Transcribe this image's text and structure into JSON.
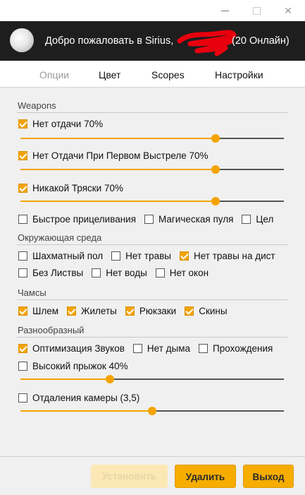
{
  "window": {
    "minimize_glyph": "",
    "maximize_glyph": "",
    "close_glyph": "✕"
  },
  "header": {
    "welcome": "Добро пожаловать в Sirius,",
    "online": "(20 Онлайн)",
    "redact_color": "#e8000e"
  },
  "tabs": [
    "Опции",
    "Цвет",
    "Scopes",
    "Настройки"
  ],
  "sections": {
    "weapons": "Weapons",
    "environment": "Окружающая среда",
    "chams": "Чамсы",
    "misc": "Разнообразный"
  },
  "weapons": {
    "no_recoil": {
      "label": "Нет отдачи 70%",
      "checked": true,
      "value": 0.74
    },
    "no_first_recoil": {
      "label": "Нет Отдачи При Первом Выстреле 70%",
      "checked": true,
      "value": 0.74
    },
    "no_shake": {
      "label": "Никакой Тряски 70%",
      "checked": true,
      "value": 0.74
    },
    "row": [
      {
        "label": "Быстрое прицеливания",
        "checked": false
      },
      {
        "label": "Магическая пуля",
        "checked": false
      },
      {
        "label": "Цел",
        "checked": false
      }
    ]
  },
  "environment": {
    "row1": [
      {
        "label": "Шахматный пол",
        "checked": false
      },
      {
        "label": "Нет травы",
        "checked": false
      },
      {
        "label": "Нет травы на дист",
        "checked": true
      }
    ],
    "row2": [
      {
        "label": "Без Листвы",
        "checked": false
      },
      {
        "label": "Нет воды",
        "checked": false
      },
      {
        "label": "Нет окон",
        "checked": false
      }
    ]
  },
  "chams": [
    {
      "label": "Шлем",
      "checked": true
    },
    {
      "label": "Жилеты",
      "checked": true
    },
    {
      "label": "Рюкзаки",
      "checked": true
    },
    {
      "label": "Скины",
      "checked": true
    }
  ],
  "misc": {
    "row": [
      {
        "label": "Оптимизация Звуков",
        "checked": true
      },
      {
        "label": "Нет дыма",
        "checked": false
      },
      {
        "label": "Прохождения",
        "checked": false
      }
    ],
    "high_jump": {
      "label": "Высокий прыжок 40%",
      "checked": false,
      "value": 0.34
    },
    "camera_distance": {
      "label": "Отдаления камеры (3,5)",
      "checked": false,
      "value": 0.5
    }
  },
  "footer": {
    "install": "Установить",
    "delete": "Удалить",
    "exit": "Выход"
  },
  "colors": {
    "accent": "#f4a400",
    "header_bg": "#1e1e1e",
    "panel_bg": "#f0f0f0"
  }
}
